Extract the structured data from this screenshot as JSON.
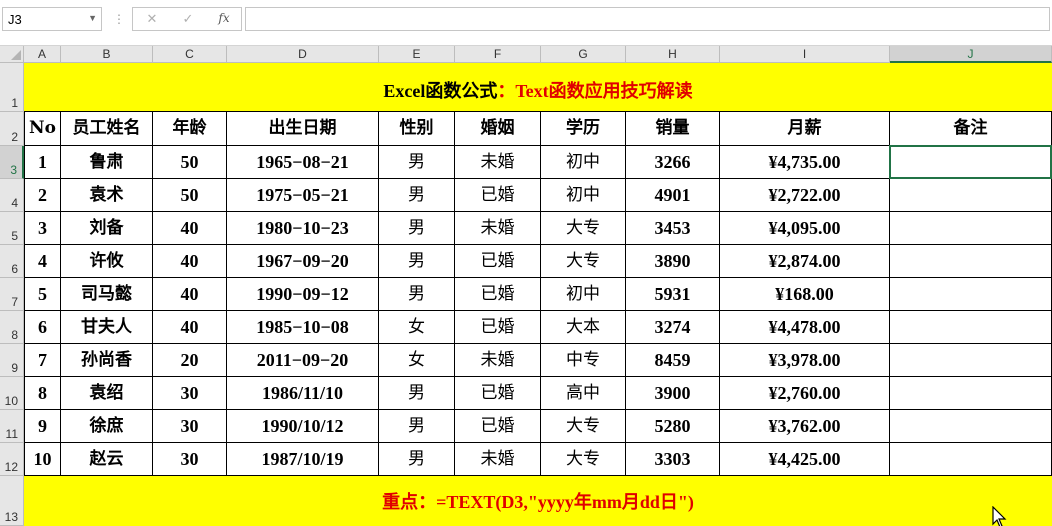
{
  "formula_bar": {
    "name_box": "J3",
    "separator": "⋮",
    "cancel_glyph": "✕",
    "enter_glyph": "✓",
    "fx_glyph": "fx",
    "formula_value": ""
  },
  "columns": [
    "A",
    "B",
    "C",
    "D",
    "E",
    "F",
    "G",
    "H",
    "I",
    "J"
  ],
  "rows": [
    "1",
    "2",
    "3",
    "4",
    "5",
    "6",
    "7",
    "8",
    "9",
    "10",
    "11",
    "12",
    "13"
  ],
  "active_column": "J",
  "active_row": "3",
  "title": {
    "black_part": "Excel函数公式",
    "red_part": "：Text函数应用技巧解读",
    "background": "#ffff00"
  },
  "headers": [
    "No",
    "员工姓名",
    "年龄",
    "出生日期",
    "性别",
    "婚姻",
    "学历",
    "销量",
    "月薪",
    "备注"
  ],
  "table_rows": [
    [
      "1",
      "鲁肃",
      "50",
      "1965−08−21",
      "男",
      "未婚",
      "初中",
      "3266",
      "¥4,735.00",
      ""
    ],
    [
      "2",
      "袁术",
      "50",
      "1975−05−21",
      "男",
      "已婚",
      "初中",
      "4901",
      "¥2,722.00",
      ""
    ],
    [
      "3",
      "刘备",
      "40",
      "1980−10−23",
      "男",
      "未婚",
      "大专",
      "3453",
      "¥4,095.00",
      ""
    ],
    [
      "4",
      "许攸",
      "40",
      "1967−09−20",
      "男",
      "已婚",
      "大专",
      "3890",
      "¥2,874.00",
      ""
    ],
    [
      "5",
      "司马懿",
      "40",
      "1990−09−12",
      "男",
      "已婚",
      "初中",
      "5931",
      "¥168.00",
      ""
    ],
    [
      "6",
      "甘夫人",
      "40",
      "1985−10−08",
      "女",
      "已婚",
      "大本",
      "3274",
      "¥4,478.00",
      ""
    ],
    [
      "7",
      "孙尚香",
      "20",
      "2011−09−20",
      "女",
      "未婚",
      "中专",
      "8459",
      "¥3,978.00",
      ""
    ],
    [
      "8",
      "袁绍",
      "30",
      "1986/11/10",
      "男",
      "已婚",
      "高中",
      "3900",
      "¥2,760.00",
      ""
    ],
    [
      "9",
      "徐庶",
      "30",
      "1990/10/12",
      "男",
      "已婚",
      "大专",
      "5280",
      "¥3,762.00",
      ""
    ],
    [
      "10",
      "赵云",
      "30",
      "1987/10/19",
      "男",
      "未婚",
      "大专",
      "3303",
      "¥4,425.00",
      ""
    ]
  ],
  "footer": {
    "text": "重点：=TEXT(D3,\"yyyy年mm月dd日\")",
    "color": "#e00000"
  },
  "colors": {
    "highlight": "#ffff00",
    "accent": "#217346",
    "red": "#e00000"
  },
  "icons": {
    "name_box_dropdown": "chevron-down-icon",
    "cursor": "mouse-pointer-icon"
  }
}
